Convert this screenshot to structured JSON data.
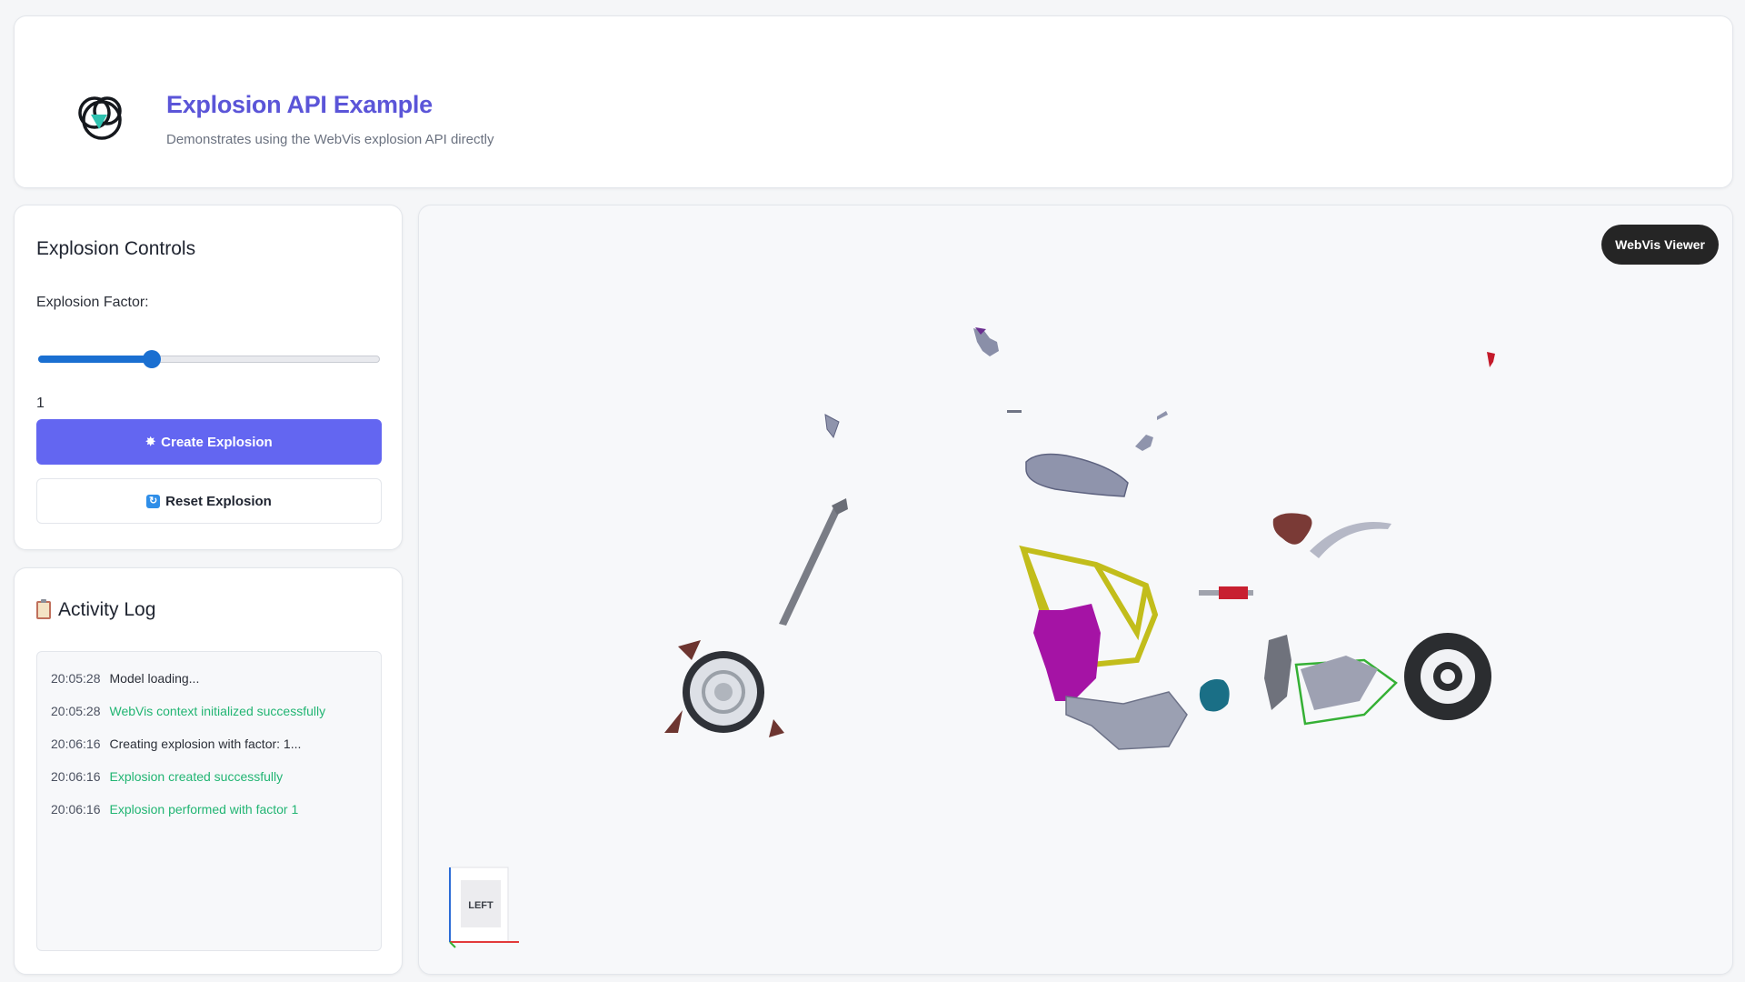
{
  "header": {
    "title": "Explosion API Example",
    "subtitle": "Demonstrates using the WebVis explosion API directly",
    "logo_icon": "webvis-logo-icon"
  },
  "controls": {
    "title": "Explosion Controls",
    "factor_label": "Explosion Factor:",
    "factor_value": "1",
    "slider": {
      "min": 0,
      "max": 3,
      "value": 1,
      "fill_color": "#1a6fd1"
    },
    "create_button": {
      "label": "Create Explosion",
      "icon": "explosion-icon"
    },
    "reset_button": {
      "label": "Reset Explosion",
      "icon": "reset-icon"
    }
  },
  "activity": {
    "title": "Activity Log",
    "icon": "clipboard-icon",
    "entries": [
      {
        "time": "20:05:28",
        "message": "Model loading...",
        "status": "info"
      },
      {
        "time": "20:05:28",
        "message": "WebVis context initialized successfully",
        "status": "success"
      },
      {
        "time": "20:06:16",
        "message": "Creating explosion with factor: 1...",
        "status": "info"
      },
      {
        "time": "20:06:16",
        "message": "Explosion created successfully",
        "status": "success"
      },
      {
        "time": "20:06:16",
        "message": "Explosion performed with factor 1",
        "status": "success"
      }
    ]
  },
  "viewer": {
    "badge": "WebVis Viewer",
    "nav_cube_face": "LEFT"
  },
  "colors": {
    "accent": "#6366f1",
    "title": "#5b55d8",
    "success": "#22b573",
    "badge_bg": "#252525"
  }
}
